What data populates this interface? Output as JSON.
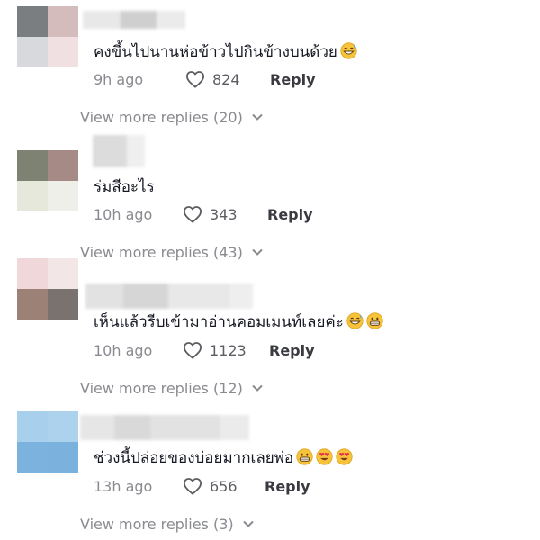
{
  "comments": [
    {
      "text": "คงขึ้นไปนานห่อข้าวไปกินข้างบนด้วย",
      "emojis": [
        "grinning-sweat-emoji"
      ],
      "time": "9h ago",
      "likes": "824",
      "reply_label": "Reply",
      "view_more": "View more replies (20)",
      "avatar_colors": [
        "#7b7e80",
        "#d4bcbc",
        "#d7d9dc",
        "#f0e0e2"
      ],
      "name_blur_colors": [
        "#e8e8e8",
        "#cfcfcf",
        "#ebebeb"
      ]
    },
    {
      "text": "ร่มสีอะไร",
      "emojis": [],
      "time": "10h ago",
      "likes": "343",
      "reply_label": "Reply",
      "view_more": "View more replies (43)",
      "avatar_colors": [
        "#7d8272",
        "#a68a86",
        "#e6e8dc",
        "#efefe9"
      ],
      "name_blur_colors": [
        "#dcdcdc",
        "#efefef"
      ]
    },
    {
      "text": "เห็นแล้วรีบเข้ามาอ่านคอมเมนท์เลยค่ะ",
      "emojis": [
        "grinning-sweat-emoji",
        "grinning-emoji"
      ],
      "time": "10h ago",
      "likes": "1123",
      "reply_label": "Reply",
      "view_more": "View more replies (12)",
      "avatar_colors": [
        "#f0d7d9",
        "#f2e6e6",
        "#9c8276",
        "#7a726e"
      ],
      "name_blur_colors": [
        "#e2e2e2",
        "#d6d6d6",
        "#e8e8e8",
        "#eeeeee"
      ]
    },
    {
      "text": "ช่วงนี้ปล่อยของบ่อยมากเลยพ่อ",
      "emojis": [
        "grinning-emoji",
        "heart-eyes-emoji",
        "heart-eyes-emoji"
      ],
      "time": "13h ago",
      "likes": "656",
      "reply_label": "Reply",
      "view_more": "View more replies (3)",
      "avatar_colors": [
        "#a8d0ec",
        "#acd2ee",
        "#7bb3de",
        "#7ab2dd"
      ],
      "name_blur_colors": [
        "#e6e6e6",
        "#d9d9d9",
        "#e2e2e2",
        "#ebebeb"
      ]
    }
  ]
}
